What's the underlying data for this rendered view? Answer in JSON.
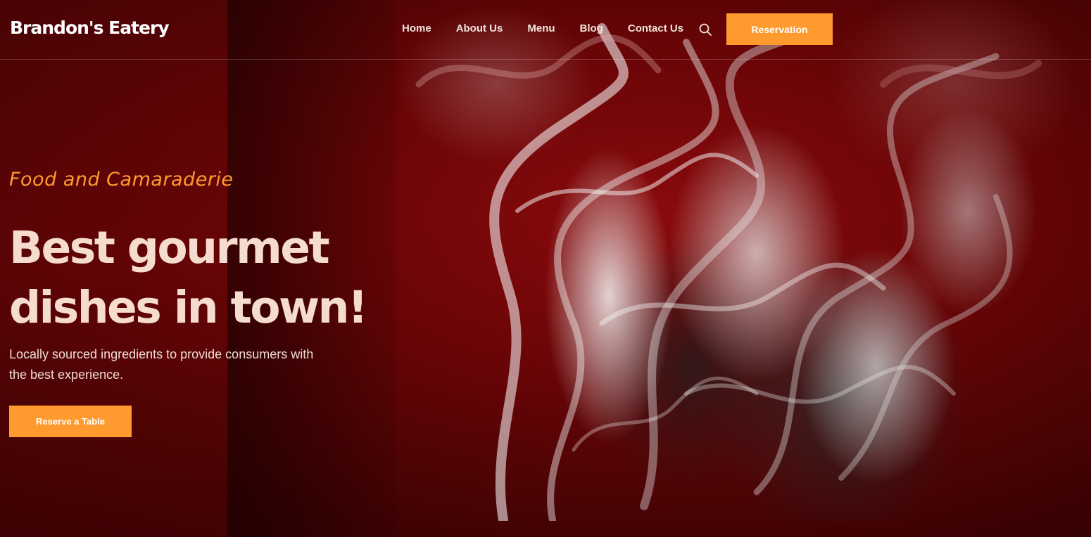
{
  "header": {
    "logo": "Brandon's Eatery",
    "nav": [
      {
        "label": "Home"
      },
      {
        "label": "About Us"
      },
      {
        "label": "Menu"
      },
      {
        "label": "Blog"
      },
      {
        "label": "Contact Us"
      }
    ],
    "search_icon": "search-icon",
    "reservation_label": "Reservation"
  },
  "hero": {
    "tagline": "Food and Camaraderie",
    "headline_line1": "Best gourmet",
    "headline_line2": "dishes in town!",
    "description": "Locally sourced ingredients to provide consumers with the best experience.",
    "cta_label": "Reserve a Table"
  },
  "colors": {
    "accent": "#ff9a2e",
    "background": "#6a0507",
    "headline": "#f6dbcf"
  }
}
